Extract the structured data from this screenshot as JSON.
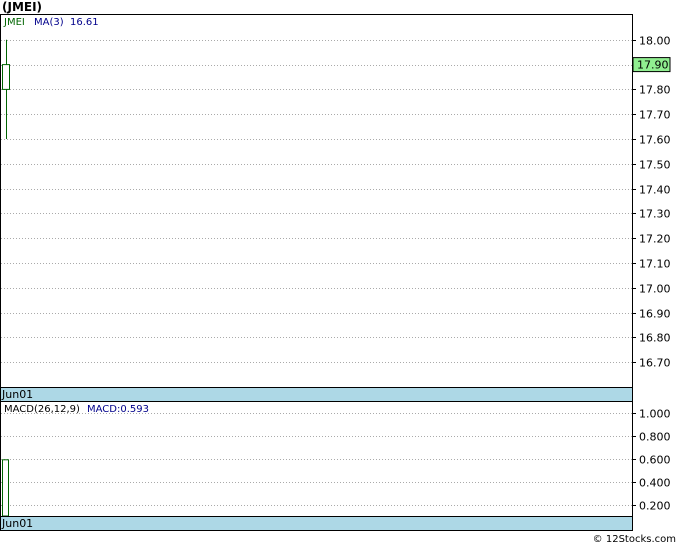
{
  "title": "(JMEI)",
  "copyright": "© 12Stocks.com",
  "chart_data": [
    {
      "type": "candlestick",
      "legend": {
        "ticker": "JMEI",
        "ma_label": "MA(3)",
        "ma_value": "16.61"
      },
      "ylim": [
        16.6,
        18.1
      ],
      "yticks": [
        "18.00",
        "17.90",
        "17.80",
        "17.70",
        "17.60",
        "17.50",
        "17.40",
        "17.30",
        "17.20",
        "17.10",
        "17.00",
        "16.90",
        "16.80",
        "16.70"
      ],
      "last_price": "17.90",
      "x_label": "Jun01",
      "candles": [
        {
          "date": "Jun01",
          "open": 17.8,
          "high": 18.0,
          "low": 17.6,
          "close": 17.9
        }
      ],
      "colors": {
        "candle": "#006400",
        "grid": "#aaaaaa",
        "axis_band": "#add8e6",
        "price_box": "#90ee90",
        "ma_text": "#00008b"
      }
    },
    {
      "type": "bar",
      "legend": {
        "indicator": "MACD(26,12,9)",
        "value_label": "MACD:0.593"
      },
      "ylim": [
        0.1,
        1.1
      ],
      "yticks": [
        "1.000",
        "0.800",
        "0.600",
        "0.400",
        "0.200"
      ],
      "x_label": "Jun01",
      "bars": [
        {
          "date": "Jun01",
          "value": 0.593
        }
      ],
      "colors": {
        "bar": "#006400",
        "grid": "#aaaaaa",
        "axis_band": "#add8e6",
        "value_text": "#00008b"
      }
    }
  ]
}
